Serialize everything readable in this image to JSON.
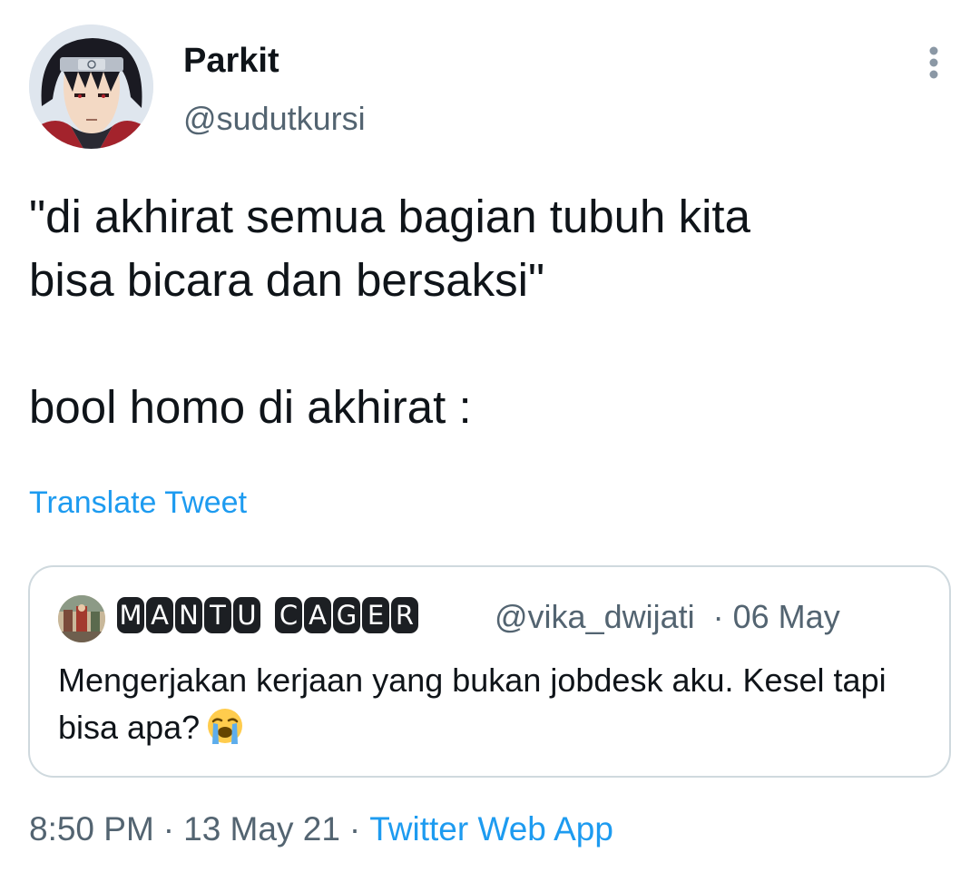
{
  "author": {
    "display_name": "Parkit",
    "handle": "@sudutkursi",
    "avatar_icon": "anime-character-avatar"
  },
  "menu": {
    "icon": "more-vertical-icon"
  },
  "tweet": {
    "text": "\"di akhirat semua bagian tubuh kita\nbisa bicara dan bersaksi\"\n\nbool homo di akhirat :",
    "translate_label": "Translate Tweet"
  },
  "quoted_tweet": {
    "avatar_icon": "photo-avatar",
    "name_words": [
      [
        "M",
        "A",
        "N",
        "T",
        "U"
      ],
      [
        "C",
        "A",
        "G",
        "E",
        "R"
      ]
    ],
    "handle": "@vika_dwijati",
    "separator": "·",
    "date": "06 May",
    "text": "Mengerjakan kerjaan yang bukan jobdesk aku. Kesel tapi bisa apa?",
    "emoji": "loudly-crying-face-emoji"
  },
  "meta": {
    "time": "8:50 PM",
    "separator": "·",
    "date": "13 May 21",
    "source": "Twitter Web App"
  },
  "colors": {
    "text_primary": "#0f1419",
    "text_secondary": "#536471",
    "link": "#1d9bf0",
    "border": "#cfd9de"
  }
}
